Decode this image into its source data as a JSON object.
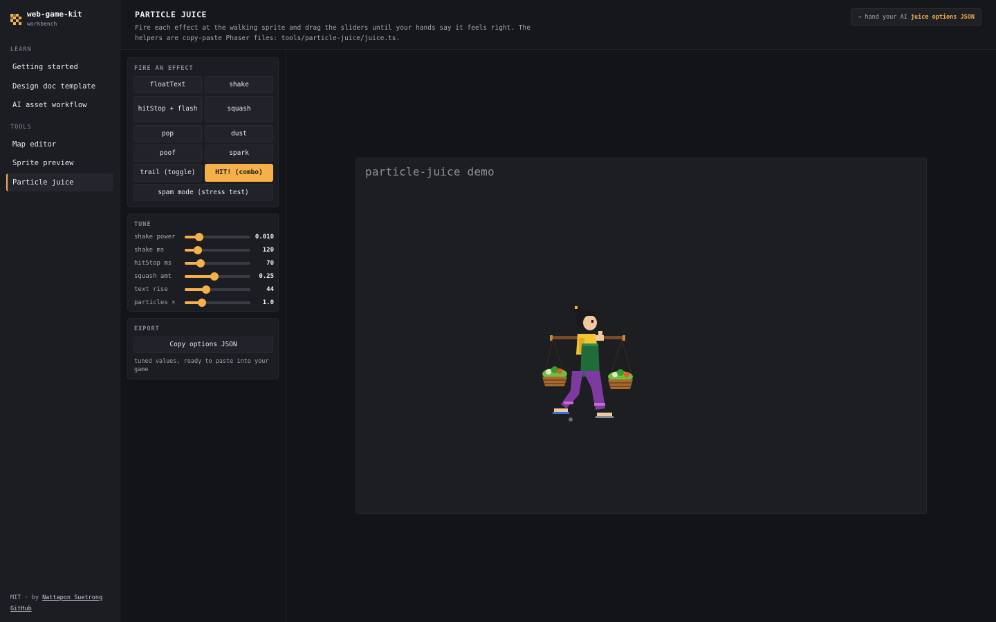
{
  "sidebar": {
    "brand_name": "web-game-kit",
    "brand_sub": "workbench",
    "sections": [
      {
        "label": "LEARN",
        "items": [
          "Getting started",
          "Design doc template",
          "AI asset workflow"
        ]
      },
      {
        "label": "TOOLS",
        "items": [
          "Map editor",
          "Sprite preview",
          "Particle juice"
        ]
      }
    ],
    "active_item": "Particle juice",
    "footer": {
      "license": "MIT · by ",
      "author": "Nattapon Suetrong",
      "github": "GitHub"
    }
  },
  "header": {
    "title": "PARTICLE JUICE",
    "description": "Fire each effect at the walking sprite and drag the sliders until your hands say it feels right. The helpers are copy-paste Phaser files: tools/particle-juice/juice.ts.",
    "hand_ai_prefix": "→ hand your AI ",
    "hand_ai_highlight": "juice options JSON"
  },
  "fire_card": {
    "title": "FIRE AN EFFECT",
    "buttons": {
      "floattext": "floatText",
      "shake": "shake",
      "hitstop": "hitStop + flash",
      "squash": "squash",
      "pop": "pop",
      "dust": "dust",
      "poof": "poof",
      "spark": "spark",
      "trail": "trail (toggle)",
      "hit": "HIT! (combo)",
      "spam": "spam mode (stress test)"
    }
  },
  "tune_card": {
    "title": "TUNE",
    "sliders": [
      {
        "label": "shake power",
        "value": "0.010",
        "fraction": 0.22
      },
      {
        "label": "shake ms",
        "value": "120",
        "fraction": 0.2
      },
      {
        "label": "hitStop ms",
        "value": "70",
        "fraction": 0.24
      },
      {
        "label": "squash amt",
        "value": "0.25",
        "fraction": 0.45
      },
      {
        "label": "text rise",
        "value": "44",
        "fraction": 0.33
      },
      {
        "label": "particles ×",
        "value": "1.0",
        "fraction": 0.26
      }
    ]
  },
  "export_card": {
    "title": "EXPORT",
    "copy_button": "Copy options JSON",
    "note": "tuned values, ready to paste into your game"
  },
  "stage": {
    "title": "particle-juice demo"
  },
  "colors": {
    "accent": "#f5b04a",
    "background": "#131418",
    "panel": "#1c1d22"
  }
}
